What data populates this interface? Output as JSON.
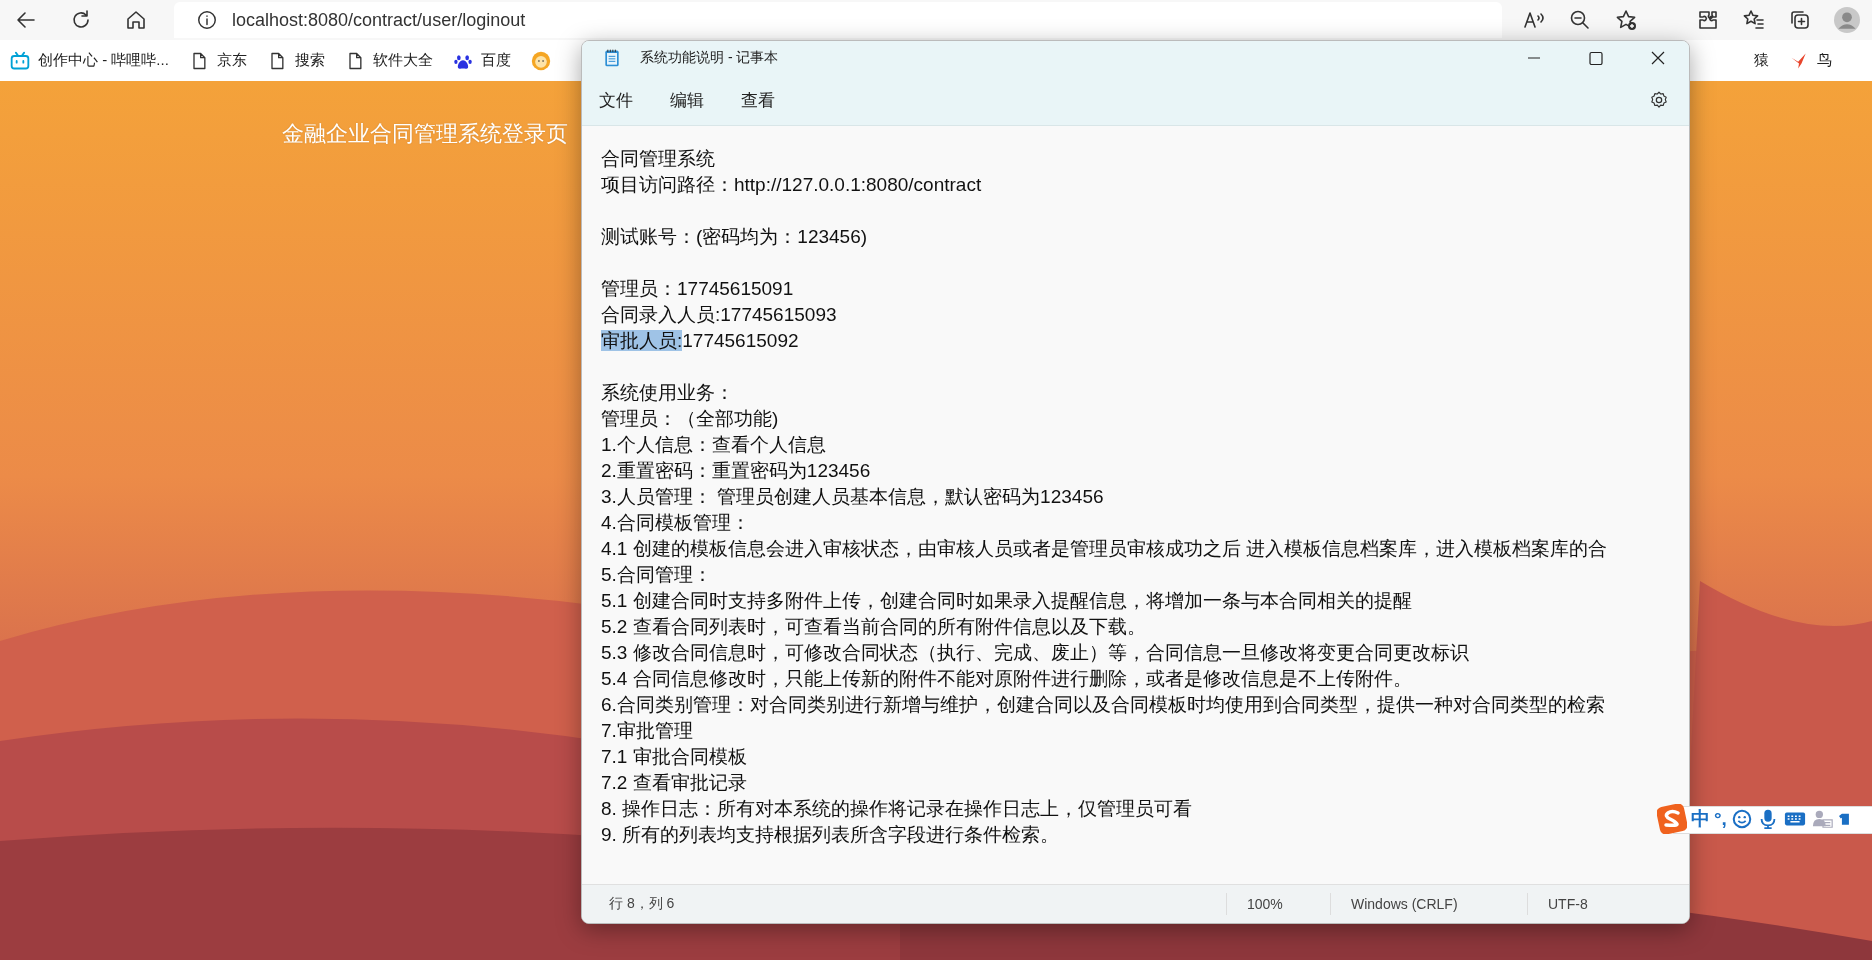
{
  "browser": {
    "address": "localhost:8080/contract/user/loginout",
    "bookmarks": [
      {
        "kind": "bilibili",
        "label": "创作中心 - 哔哩哔..."
      },
      {
        "kind": "file",
        "label": "京东"
      },
      {
        "kind": "file",
        "label": "搜索"
      },
      {
        "kind": "file",
        "label": "软件大全"
      },
      {
        "kind": "paw",
        "label": "百度"
      },
      {
        "kind": "lion"
      }
    ],
    "bookmarks_right": [
      {
        "kind": "text",
        "label": "猿"
      },
      {
        "kind": "bird",
        "label": "鸟"
      }
    ]
  },
  "page": {
    "title": "金融企业合同管理系统登录页"
  },
  "notepad": {
    "title": "系统功能说明 - 记事本",
    "menus": [
      "文件",
      "编辑",
      "查看"
    ],
    "lines": [
      {
        "kind": "text",
        "text": "合同管理系统"
      },
      {
        "kind": "text",
        "text": "项目访问路径：http://127.0.0.1:8080/contract"
      },
      {
        "kind": "blank"
      },
      {
        "kind": "text",
        "text": "测试账号：(密码均为：123456)"
      },
      {
        "kind": "blank"
      },
      {
        "kind": "text",
        "text": "管理员：17745615091"
      },
      {
        "kind": "text",
        "text": "合同录入人员:17745615093"
      },
      {
        "kind": "selection",
        "selected": "审批人员:",
        "text": "17745615092"
      },
      {
        "kind": "blank"
      },
      {
        "kind": "text",
        "text": "系统使用业务："
      },
      {
        "kind": "text",
        "text": "管理员：（全部功能)"
      },
      {
        "kind": "text",
        "text": "1.个人信息：查看个人信息"
      },
      {
        "kind": "text",
        "text": "2.重置密码：重置密码为123456"
      },
      {
        "kind": "text",
        "text": "3.人员管理： 管理员创建人员基本信息，默认密码为123456"
      },
      {
        "kind": "text",
        "text": "4.合同模板管理："
      },
      {
        "kind": "text",
        "text": "4.1 创建的模板信息会进入审核状态，由审核人员或者是管理员审核成功之后 进入模板信息档案库，进入模板档案库的合"
      },
      {
        "kind": "text",
        "text": "5.合同管理："
      },
      {
        "kind": "text",
        "text": "5.1 创建合同时支持多附件上传，创建合同时如果录入提醒信息，将增加一条与本合同相关的提醒"
      },
      {
        "kind": "text",
        "text": "5.2 查看合同列表时，可查看当前合同的所有附件信息以及下载。"
      },
      {
        "kind": "text",
        "text": "5.3 修改合同信息时，可修改合同状态（执行、完成、废止）等，合同信息一旦修改将变更合同更改标识"
      },
      {
        "kind": "text",
        "text": "5.4 合同信息修改时，只能上传新的附件不能对原附件进行删除，或者是修改信息是不上传附件。"
      },
      {
        "kind": "text",
        "text": "6.合同类别管理：对合同类别进行新增与维护，创建合同以及合同模板时均使用到合同类型，提供一种对合同类型的检索"
      },
      {
        "kind": "text",
        "text": "7.审批管理"
      },
      {
        "kind": "text",
        "text": "7.1 审批合同模板"
      },
      {
        "kind": "text",
        "text": "7.2 查看审批记录"
      },
      {
        "kind": "text",
        "text": "8. 操作日志：所有对本系统的操作将记录在操作日志上，仅管理员可看"
      },
      {
        "kind": "text",
        "text": "9. 所有的列表均支持根据列表所含字段进行条件检索。"
      }
    ],
    "status": [
      "行 8，列 6",
      "100%",
      "Windows (CRLF)",
      "UTF-8"
    ]
  },
  "ime": [
    {
      "kind": "logo"
    },
    {
      "kind": "text",
      "label": "中"
    },
    {
      "kind": "text",
      "label": "°,"
    },
    {
      "kind": "smiley"
    },
    {
      "kind": "mic"
    },
    {
      "kind": "keyboard"
    },
    {
      "kind": "user"
    },
    {
      "kind": "shirt"
    }
  ]
}
